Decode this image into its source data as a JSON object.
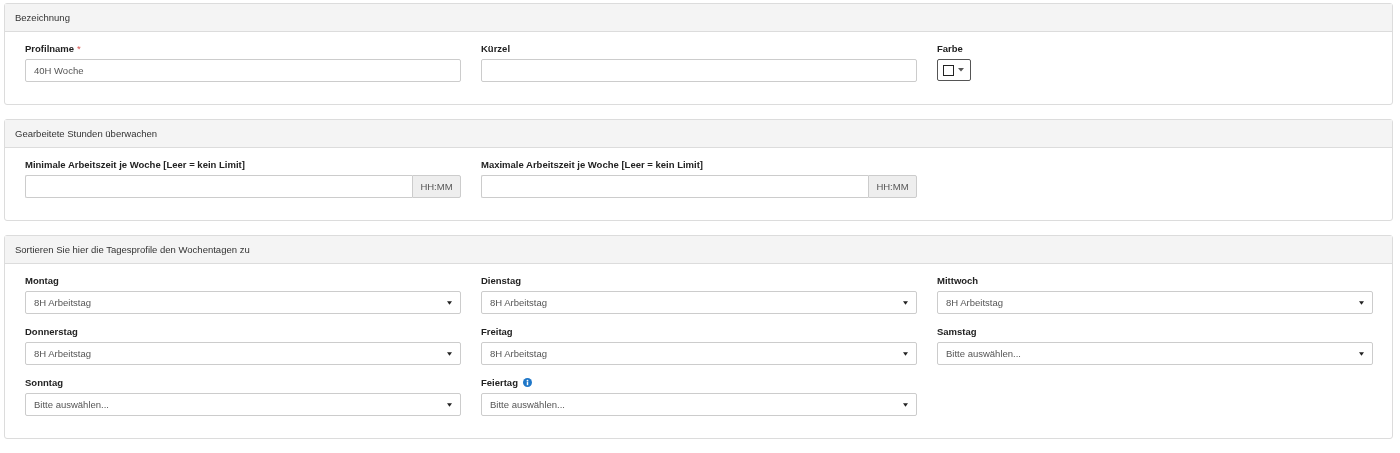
{
  "sections": [
    {
      "title": "Bezeichnung",
      "fields": [
        {
          "kind": "text",
          "label": "Profilname",
          "required_marker": "*",
          "info": false,
          "value": "40H Woche"
        },
        {
          "kind": "text",
          "label": "Kürzel",
          "info": false
        },
        {
          "kind": "color",
          "label": "Farbe",
          "info": false
        }
      ]
    },
    {
      "title": "Gearbeitete Stunden überwachen",
      "fields": [
        {
          "kind": "time",
          "label": "Minimale Arbeitszeit je Woche [Leer = kein Limit]",
          "info": false,
          "addon": "HH:MM"
        },
        {
          "kind": "time",
          "label": "Maximale Arbeitszeit je Woche [Leer = kein Limit]",
          "info": false,
          "addon": "HH:MM"
        }
      ]
    },
    {
      "title": "Sortieren Sie hier die Tagesprofile den Wochentagen zu",
      "fields": [
        {
          "kind": "select",
          "label": "Montag",
          "info": false,
          "value": "8H Arbeitstag"
        },
        {
          "kind": "select",
          "label": "Dienstag",
          "info": false,
          "value": "8H Arbeitstag"
        },
        {
          "kind": "select",
          "label": "Mittwoch",
          "info": false,
          "value": "8H Arbeitstag"
        },
        {
          "kind": "select",
          "label": "Donnerstag",
          "info": false,
          "value": "8H Arbeitstag"
        },
        {
          "kind": "select",
          "label": "Freitag",
          "info": false,
          "value": "8H Arbeitstag"
        },
        {
          "kind": "select",
          "label": "Samstag",
          "info": false,
          "value": "Bitte auswählen..."
        },
        {
          "kind": "select",
          "label": "Sonntag",
          "info": false,
          "value": "Bitte auswählen..."
        },
        {
          "kind": "select",
          "label": "Feiertag",
          "info": true,
          "value": "Bitte auswählen..."
        }
      ]
    }
  ]
}
